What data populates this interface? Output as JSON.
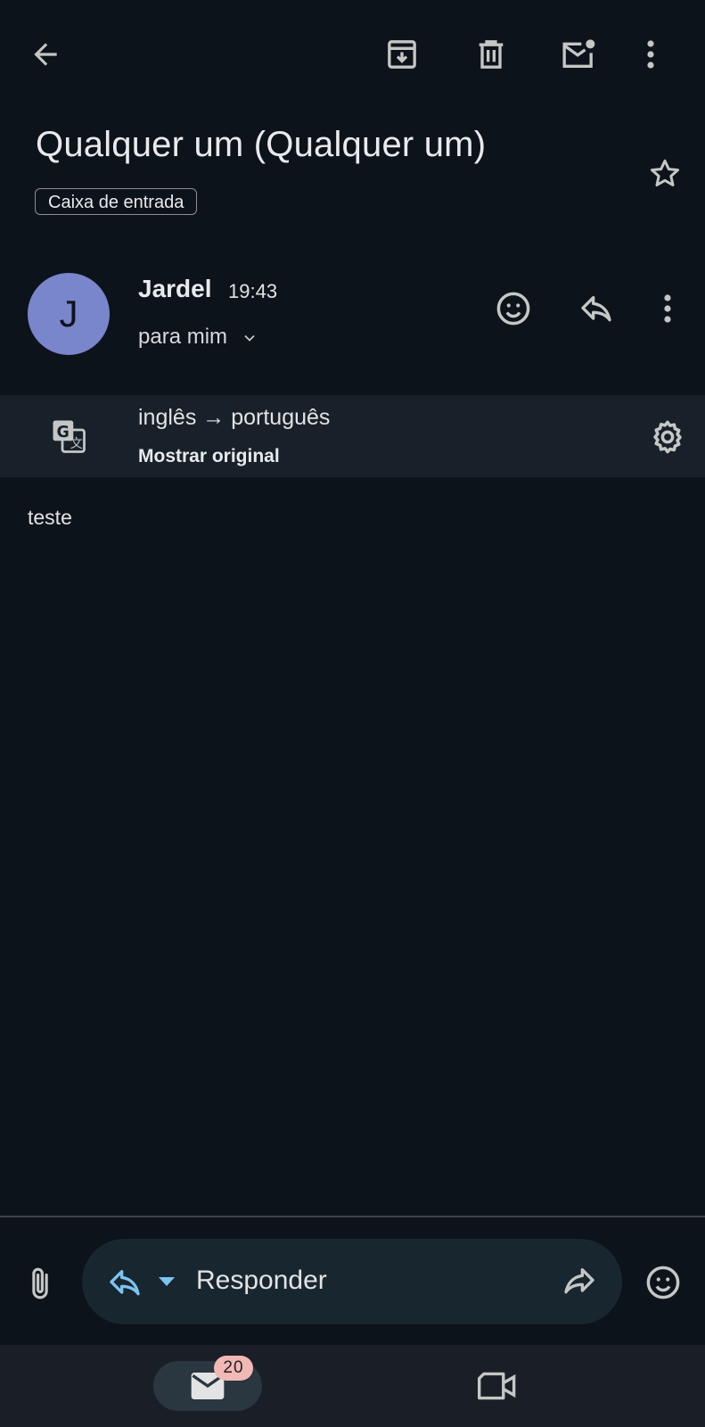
{
  "toolbar": {
    "back_icon": "arrow-left-icon",
    "archive_icon": "archive-icon",
    "delete_icon": "trash-icon",
    "mark_unread_icon": "mail-unread-icon",
    "more_icon": "more-vert-icon"
  },
  "message": {
    "subject": "Qualquer um (Qualquer um)",
    "label": "Caixa de entrada",
    "star_icon": "star-outline-icon",
    "avatar_letter": "J",
    "avatar_color": "#7986cb",
    "sender": "Jardel",
    "time": "19:43",
    "recipients": "para mim",
    "body": "teste"
  },
  "translation": {
    "languages": "inglês → português",
    "show_original": "Mostrar original",
    "translate_icon": "translate-icon",
    "settings_icon": "gear-icon"
  },
  "reply_bar": {
    "placeholder": "Responder",
    "attach_icon": "paperclip-icon",
    "reply_icon": "reply-icon",
    "dropdown_icon": "caret-down-icon",
    "forward_icon": "forward-icon",
    "emoji_icon": "emoji-icon"
  },
  "bottom_nav": {
    "mail_badge": "20",
    "mail_icon": "mail-icon",
    "meet_icon": "video-icon"
  },
  "colors": {
    "background": "#0d131a",
    "accent_blue": "#7cc4f0",
    "badge": "#f2b8b5"
  }
}
